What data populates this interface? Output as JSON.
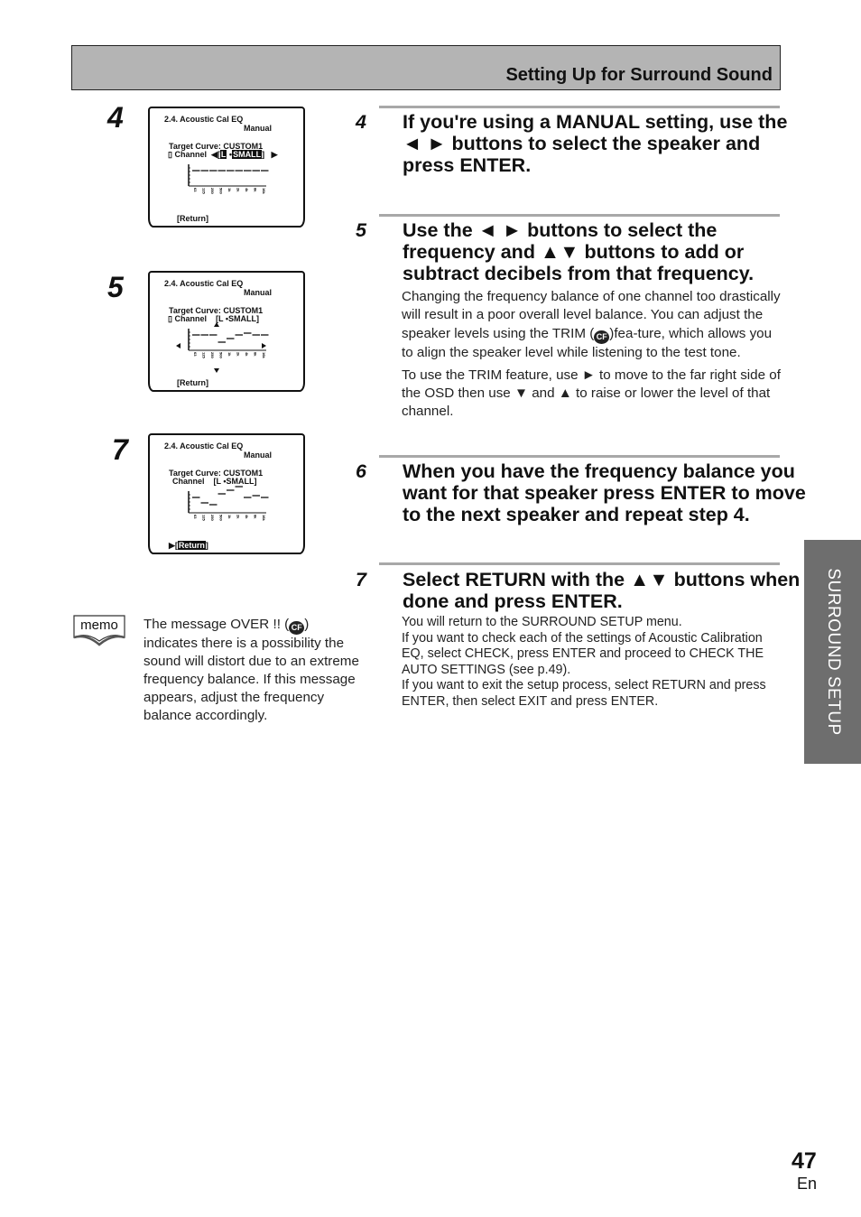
{
  "header": {
    "title": "Setting Up for Surround Sound"
  },
  "side_tab": {
    "label": "SURROUND SETUP"
  },
  "figures": [
    {
      "step": "4",
      "title_line1": "2.4. Acoustic  Cal  EQ",
      "title_line2": "Manual",
      "target_curve": "Target Curve: CUSTOM1",
      "channel_label": "Channel",
      "channel_speaker": "L",
      "channel_size": "SMALL",
      "channel_highlighted": true,
      "return_label": "[Return]",
      "return_selected": false,
      "nav_arrows": "left-right",
      "eq_levels_db": [
        0,
        0,
        0,
        0,
        0,
        0,
        0,
        0,
        0
      ]
    },
    {
      "step": "5",
      "title_line1": "2.4. Acoustic  Cal  EQ",
      "title_line2": "Manual",
      "target_curve": "Target Curve: CUSTOM1",
      "channel_label": "Channel",
      "channel_speaker": "L",
      "channel_size": "SMALL",
      "channel_highlighted": false,
      "return_label": "[Return]",
      "return_selected": false,
      "nav_arrows": "all",
      "eq_levels_db": [
        0,
        0,
        0,
        -4,
        -2,
        0,
        1,
        0,
        0
      ]
    },
    {
      "step": "7",
      "title_line1": "2.4. Acoustic  Cal  EQ",
      "title_line2": "Manual",
      "target_curve": "Target Curve: CUSTOM1",
      "channel_label": "Channel",
      "channel_speaker": "L",
      "channel_size": "SMALL",
      "channel_highlighted": false,
      "return_label": "Return",
      "return_selected": true,
      "nav_arrows": "none",
      "eq_levels_db": [
        0,
        -3,
        -4,
        2,
        4,
        6,
        0,
        1,
        0
      ]
    }
  ],
  "eq_bands": [
    "63",
    "125",
    "250",
    "500",
    "1k",
    "2k",
    "4k",
    "8k",
    "16k"
  ],
  "steps": [
    {
      "num": "4",
      "heading": "If you're using a MANUAL setting, use the ◄ ► buttons to select the speaker and press ENTER."
    },
    {
      "num": "5",
      "heading": "Use the ◄ ► buttons to select the frequency and ▲▼ buttons to add or subtract decibels from that frequency.",
      "paragraphs": [
        "Changing the frequency balance of one channel too drastically will result in a poor overall level balance. You can adjust the speaker levels using the TRIM (",
        ")fea-ture, which allows you to align the speaker level while listening to the test tone.",
        "To use the TRIM feature, use ► to move to the far right side of the OSD then use ▼ and ▲ to raise or lower the level of that channel."
      ]
    },
    {
      "num": "6",
      "heading": "When you have the frequency balance you want for that speaker press ENTER to move to the next speaker and repeat step 4."
    },
    {
      "num": "7",
      "heading": "Select RETURN with the ▲▼ buttons when done and press ENTER.",
      "lines": [
        "You will return to the SURROUND SETUP menu.",
        "If you want to check each of the settings of Acoustic Calibration EQ, select CHECK, press ENTER and proceed to CHECK THE AUTO SETTINGS (see p.49).",
        "If you want to exit the setup process, select RETURN and press ENTER, then select EXIT and press ENTER."
      ]
    }
  ],
  "memo": {
    "icon_label": "memo",
    "text_before": "The message OVER !! (",
    "text_after": ") indicates there is a possibility the sound will distort due to an extreme frequency balance. If this message appears, adjust the frequency balance accordingly."
  },
  "icons": {
    "cross_reference": "CF"
  },
  "footer": {
    "page_number": "47",
    "language": "En"
  }
}
